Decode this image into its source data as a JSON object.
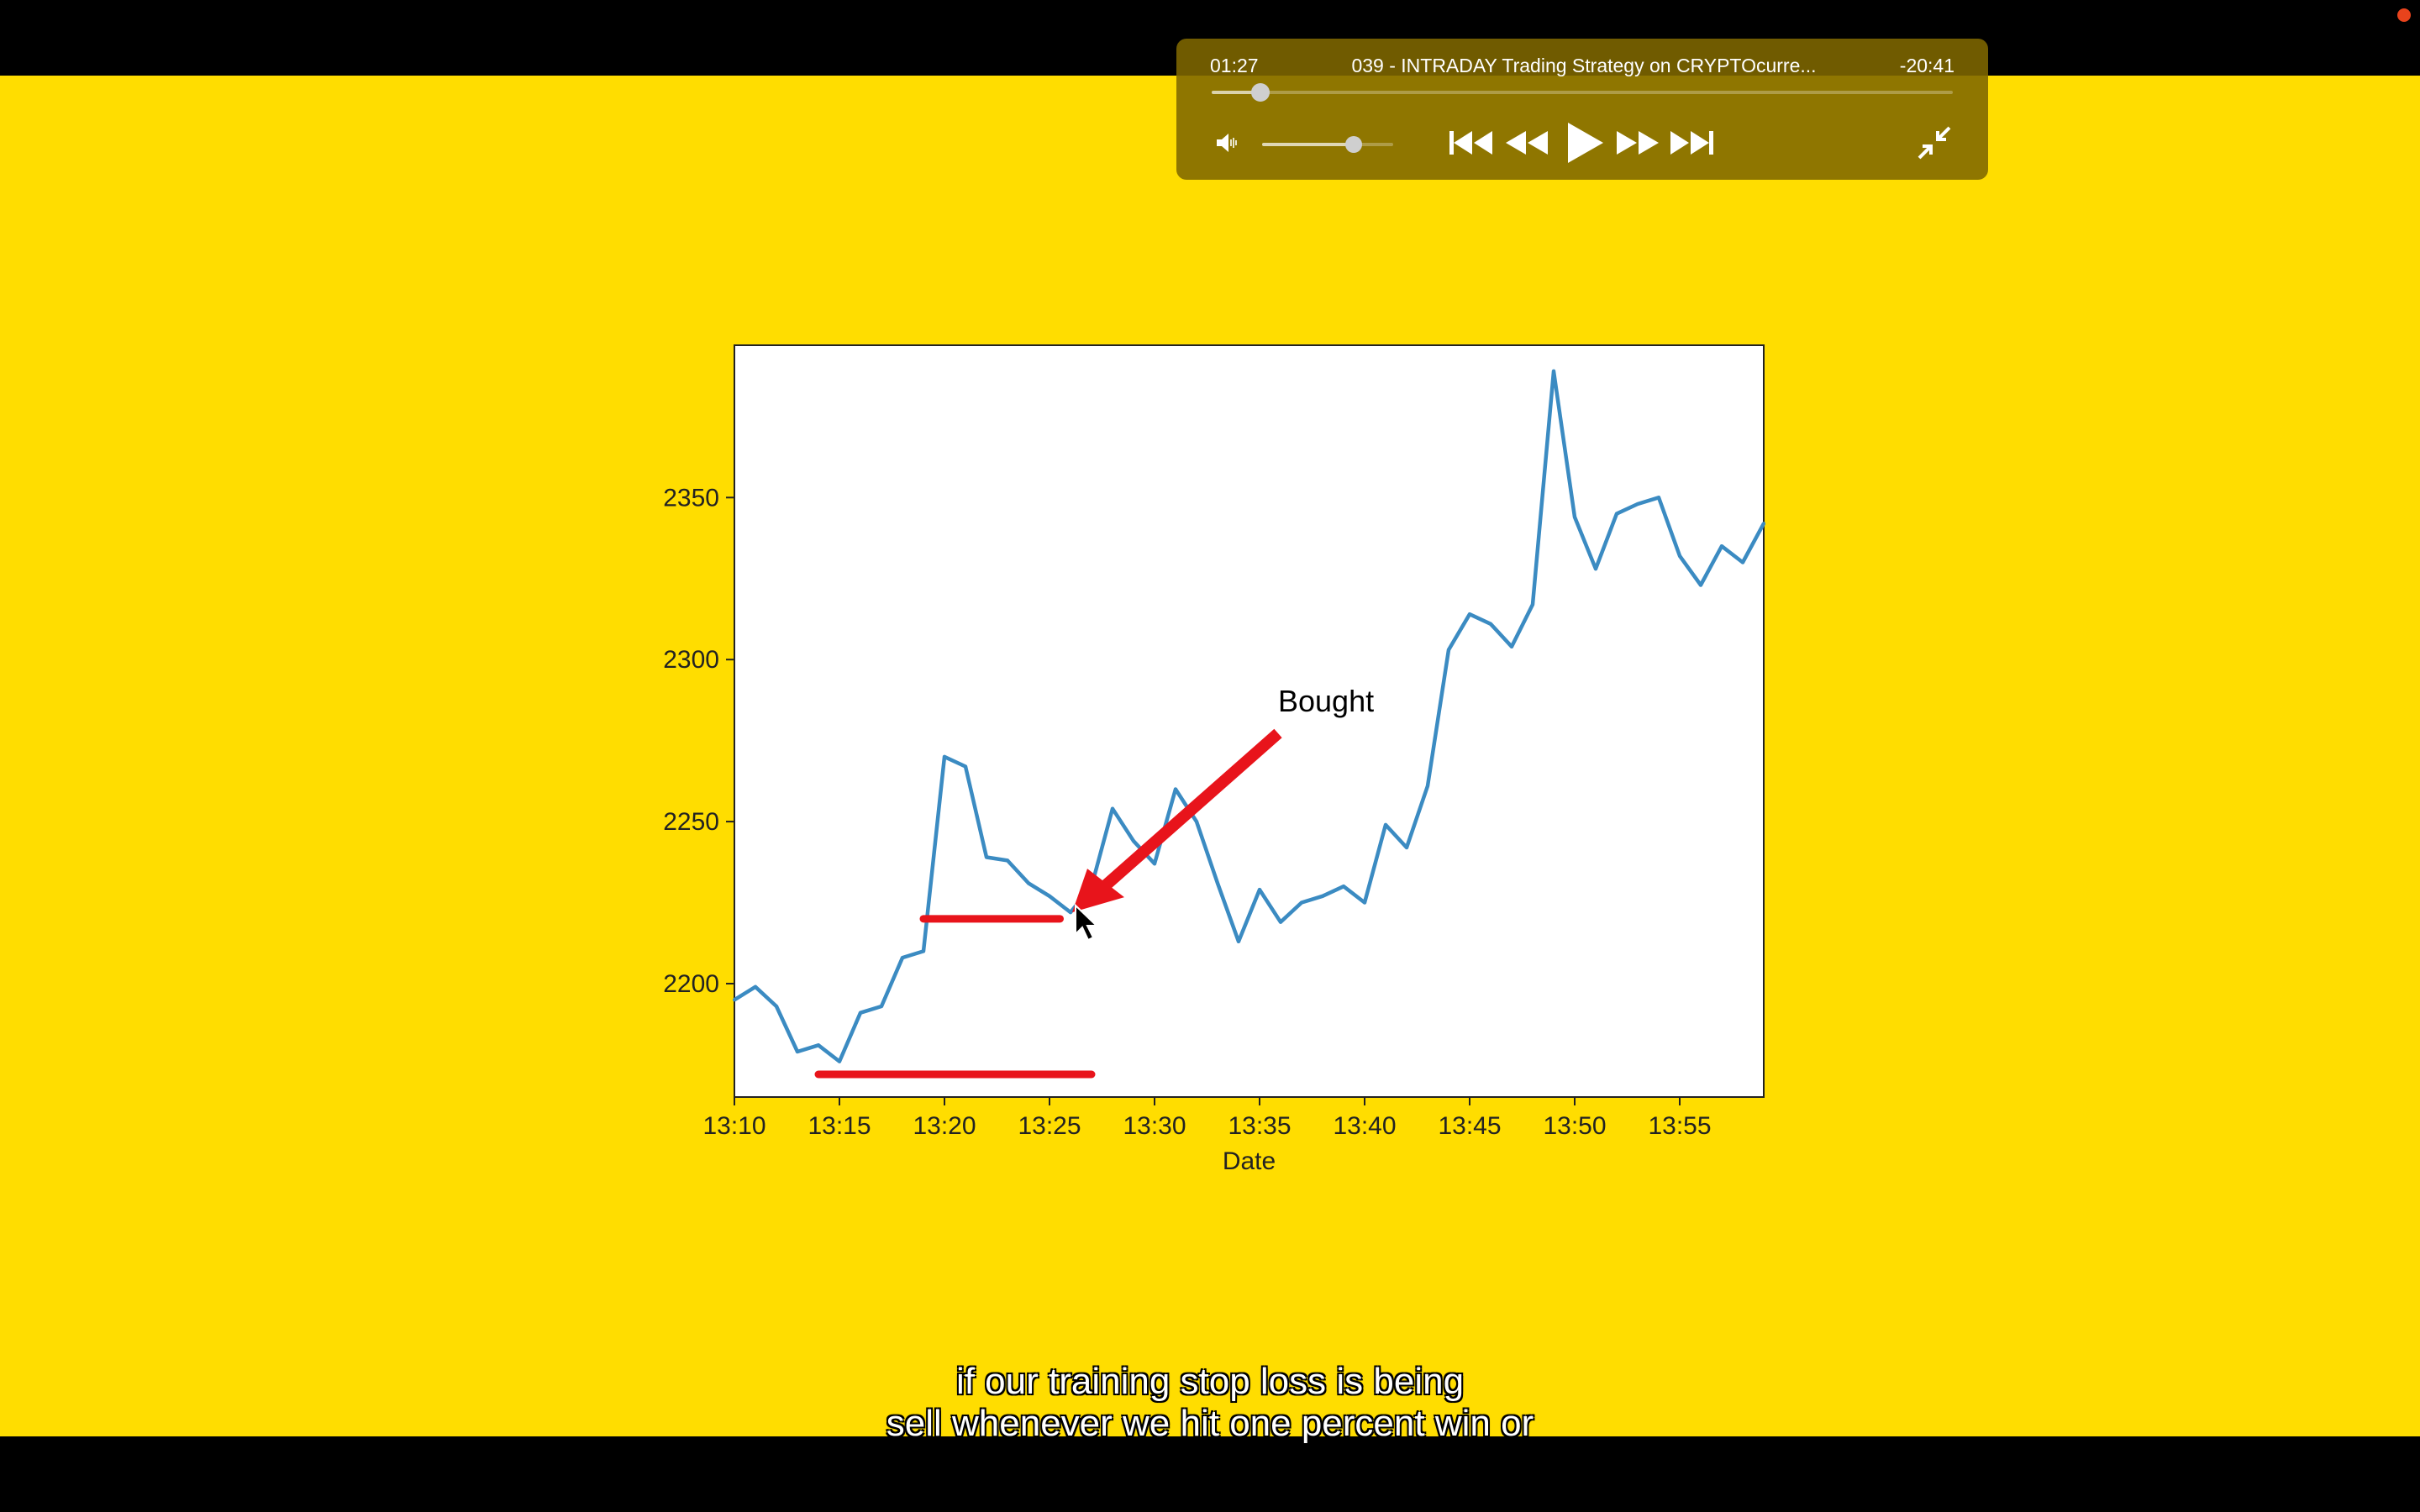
{
  "player": {
    "elapsed": "01:27",
    "title": "039 - INTRADAY Trading Strategy on CRYPTOcurre...",
    "remaining": "-20:41",
    "progress_fraction": 0.066,
    "volume_fraction": 0.7,
    "icons": {
      "volume": "speaker-volume-icon",
      "skip_back": "skip-to-start-icon",
      "rewind": "rewind-icon",
      "play": "play-icon",
      "fast_forward": "fast-forward-icon",
      "skip_forward": "skip-to-end-icon",
      "exit_fullscreen": "exit-fullscreen-icon"
    },
    "accent_color": "#806800"
  },
  "background_color": "#FFDD00",
  "chart_data": {
    "type": "line",
    "title": "",
    "xlabel": "Date",
    "ylabel": "",
    "x_ticks": [
      "13:10",
      "13:15",
      "13:20",
      "13:25",
      "13:30",
      "13:35",
      "13:40",
      "13:45",
      "13:50",
      "13:55"
    ],
    "y_ticks": [
      "2200",
      "2250",
      "2300",
      "2350"
    ],
    "ylim": [
      2165,
      2397
    ],
    "xlim_minutes": [
      "13:10",
      "13:59"
    ],
    "grid": false,
    "series": [
      {
        "color": "#3b8bc2",
        "points": [
          [
            "13:10",
            2195
          ],
          [
            "13:11",
            2199
          ],
          [
            "13:12",
            2193
          ],
          [
            "13:13",
            2179
          ],
          [
            "13:14",
            2181
          ],
          [
            "13:15",
            2176
          ],
          [
            "13:16",
            2191
          ],
          [
            "13:17",
            2193
          ],
          [
            "13:18",
            2208
          ],
          [
            "13:19",
            2210
          ],
          [
            "13:20",
            2270
          ],
          [
            "13:21",
            2267
          ],
          [
            "13:22",
            2239
          ],
          [
            "13:23",
            2238
          ],
          [
            "13:24",
            2231
          ],
          [
            "13:25",
            2227
          ],
          [
            "13:26",
            2222
          ],
          [
            "13:27",
            2230
          ],
          [
            "13:28",
            2254
          ],
          [
            "13:29",
            2244
          ],
          [
            "13:30",
            2237
          ],
          [
            "13:31",
            2260
          ],
          [
            "13:32",
            2250
          ],
          [
            "13:33",
            2231
          ],
          [
            "13:34",
            2213
          ],
          [
            "13:35",
            2229
          ],
          [
            "13:36",
            2219
          ],
          [
            "13:37",
            2225
          ],
          [
            "13:38",
            2227
          ],
          [
            "13:39",
            2230
          ],
          [
            "13:40",
            2225
          ],
          [
            "13:41",
            2249
          ],
          [
            "13:42",
            2242
          ],
          [
            "13:43",
            2261
          ],
          [
            "13:44",
            2303
          ],
          [
            "13:45",
            2314
          ],
          [
            "13:46",
            2311
          ],
          [
            "13:47",
            2304
          ],
          [
            "13:48",
            2317
          ],
          [
            "13:49",
            2389
          ],
          [
            "13:50",
            2344
          ],
          [
            "13:51",
            2328
          ],
          [
            "13:52",
            2345
          ],
          [
            "13:53",
            2348
          ],
          [
            "13:54",
            2350
          ],
          [
            "13:55",
            2332
          ],
          [
            "13:56",
            2323
          ],
          [
            "13:57",
            2335
          ],
          [
            "13:58",
            2330
          ],
          [
            "13:59",
            2342
          ]
        ]
      }
    ],
    "annotations": [
      {
        "text": "Bought",
        "arrow_color": "#E8141B",
        "points_to": [
          "13:26",
          2222
        ]
      },
      {
        "type": "hline",
        "y": 2220,
        "x": [
          "13:19",
          "13:25.5"
        ],
        "color": "#E8141B"
      },
      {
        "type": "hline",
        "y": 2172,
        "x": [
          "13:14",
          "13:27"
        ],
        "color": "#E8141B"
      }
    ]
  },
  "captions": {
    "line1": "if our training stop loss is being",
    "line2": "sell whenever we hit one percent win or"
  }
}
